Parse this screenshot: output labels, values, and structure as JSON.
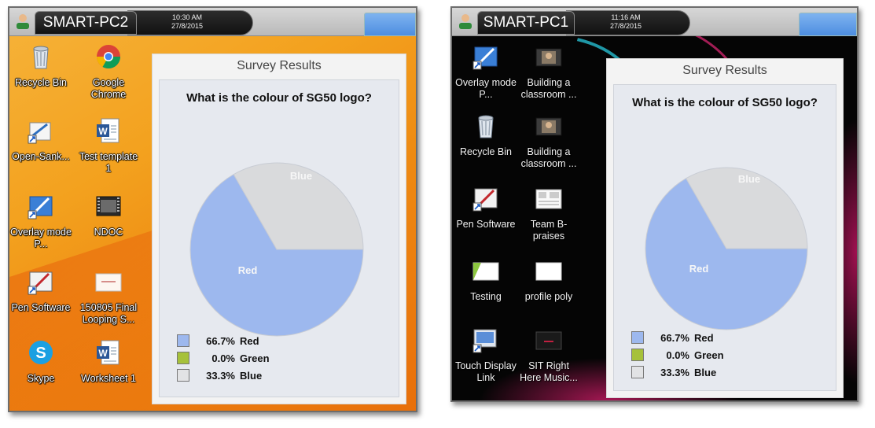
{
  "colors": {
    "red_slice": "#9db8ee",
    "green_slice": "#a6c13a",
    "blue_slice": "#d9dadc"
  },
  "left": {
    "taskbar": {
      "host": "SMART-PC2",
      "time": "10:30 AM",
      "date": "27/8/2015"
    },
    "icons": [
      {
        "label": "Recycle Bin",
        "icon": "recycle-bin-icon"
      },
      {
        "label": "Google Chrome",
        "icon": "chrome-icon"
      },
      {
        "label": "Open-Sank...",
        "icon": "shortcut-icon"
      },
      {
        "label": "Test template 1",
        "icon": "word-doc-icon"
      },
      {
        "label": "Overlay mode P...",
        "icon": "overlay-pen-icon"
      },
      {
        "label": "NDOC",
        "icon": "video-file-icon"
      },
      {
        "label": "Pen Software",
        "icon": "pen-software-icon"
      },
      {
        "label": "150805 Final Looping S...",
        "icon": "slide-thumbnail-icon"
      },
      {
        "label": "Skype",
        "icon": "skype-icon"
      },
      {
        "label": "Worksheet 1",
        "icon": "word-doc-icon"
      }
    ],
    "survey": {
      "title": "Survey Results",
      "question": "What is the colour of SG50 logo?",
      "legend": [
        {
          "pct": "66.7%",
          "name": "Red"
        },
        {
          "pct": "0.0%",
          "name": "Green"
        },
        {
          "pct": "33.3%",
          "name": "Blue"
        }
      ],
      "slice_labels": {
        "red": "Red",
        "blue": "Blue"
      }
    }
  },
  "right": {
    "taskbar": {
      "host": "SMART-PC1",
      "time": "11:16 AM",
      "date": "27/8/2015"
    },
    "icons": [
      {
        "label": "Overlay mode P...",
        "icon": "overlay-pen-icon"
      },
      {
        "label": "Building a classroom ...",
        "icon": "video-thumbnail-icon"
      },
      {
        "label": "Recycle Bin",
        "icon": "recycle-bin-icon"
      },
      {
        "label": "Building a classroom ...",
        "icon": "video-thumbnail-icon"
      },
      {
        "label": "Pen Software",
        "icon": "pen-software-icon"
      },
      {
        "label": "Team B-praises",
        "icon": "document-thumbnail-icon"
      },
      {
        "label": "Testing",
        "icon": "slide-thumbnail-icon"
      },
      {
        "label": "profile poly",
        "icon": "blank-image-icon"
      },
      {
        "label": "Touch Display Link",
        "icon": "touch-display-icon"
      },
      {
        "label": "SIT Right Here Music...",
        "icon": "music-video-icon"
      }
    ],
    "survey": {
      "title": "Survey Results",
      "question": "What is the colour of SG50 logo?",
      "legend": [
        {
          "pct": "66.7%",
          "name": "Red"
        },
        {
          "pct": "0.0%",
          "name": "Green"
        },
        {
          "pct": "33.3%",
          "name": "Blue"
        }
      ],
      "slice_labels": {
        "red": "Red",
        "blue": "Blue"
      }
    }
  }
}
